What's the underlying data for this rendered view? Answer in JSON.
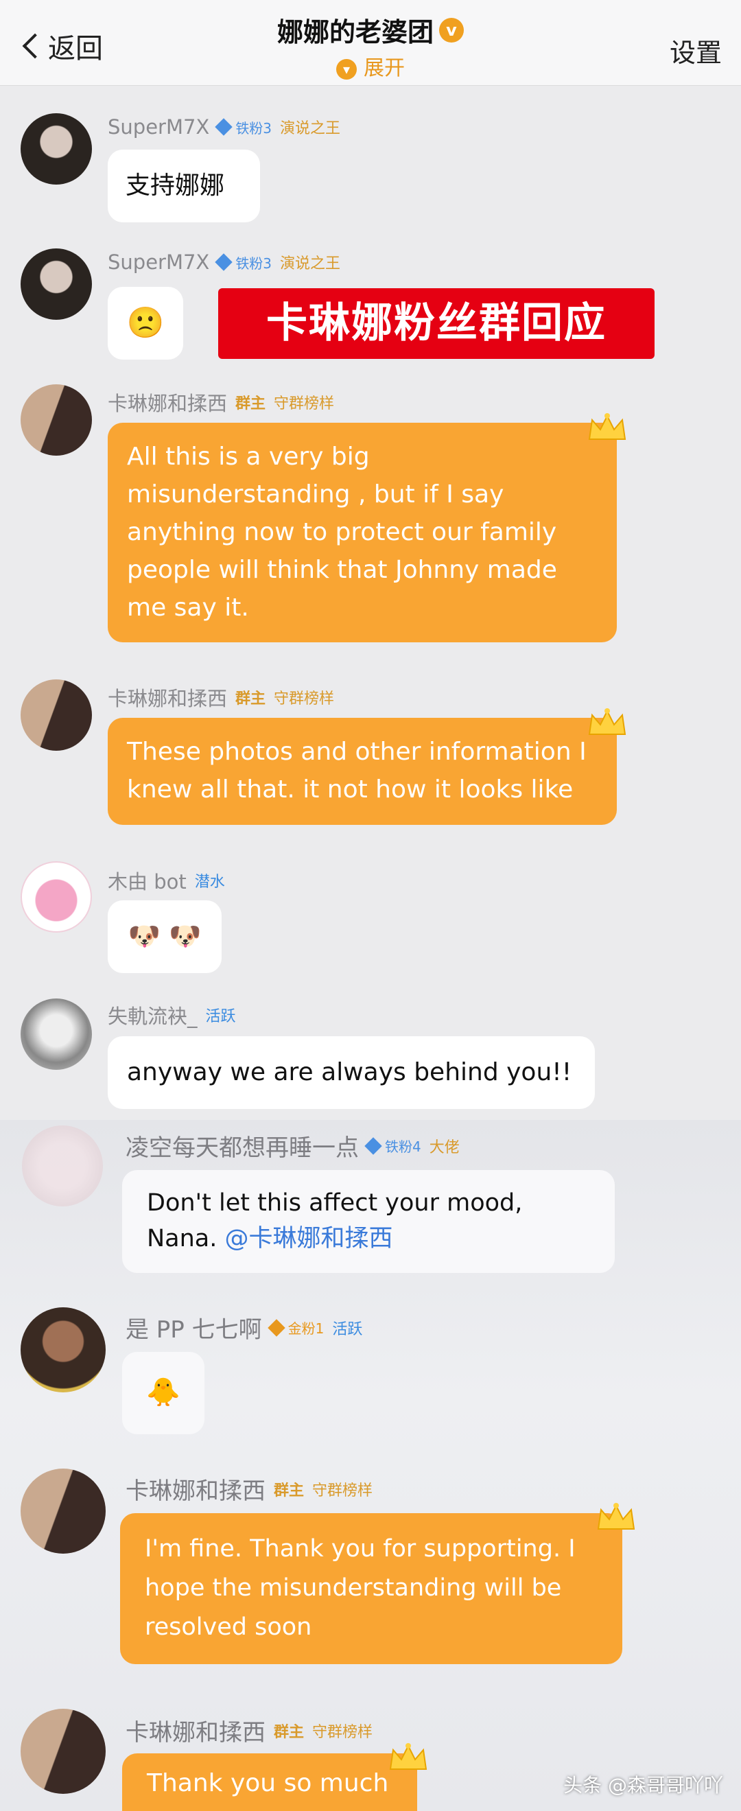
{
  "header": {
    "back_label": "返回",
    "title": "娜娜的老婆团",
    "verified_mark": "v",
    "expand_label": "展开",
    "settings_label": "设置"
  },
  "banner": {
    "text": "卡琳娜粉丝群回应"
  },
  "messages": [
    {
      "name": "SuperM7X",
      "fan_badge": "铁粉3",
      "title_badge": "演说之王",
      "text": "支持娜娜"
    },
    {
      "name": "SuperM7X",
      "fan_badge": "铁粉3",
      "title_badge": "演说之王",
      "text": "🙁"
    },
    {
      "name": "卡琳娜和揉西",
      "owner_badge": "群主",
      "title_badge": "守群榜样",
      "text": "All this is a very big misunderstanding , but if I say anything now to protect our family people will think that Johnny made me say it."
    },
    {
      "name": "卡琳娜和揉西",
      "owner_badge": "群主",
      "title_badge": "守群榜样",
      "text": "These photos and other information I knew all that. it not how it looks like"
    },
    {
      "name": "木由 bot",
      "status_badge": "潜水",
      "text": "🐶 🐶"
    },
    {
      "name": "失軌流袂_",
      "status_badge": "活跃",
      "text": "anyway we are always behind you!!"
    },
    {
      "name": "凌空每天都想再睡一点",
      "fan_badge": "铁粉4",
      "status_badge": "大佬",
      "text": "Don't let this affect your mood, Nana.",
      "mention": "@卡琳娜和揉西"
    },
    {
      "name": "是 PP 七七啊",
      "fan_badge": "金粉1",
      "status_badge": "活跃",
      "text": "🐥"
    },
    {
      "name": "卡琳娜和揉西",
      "owner_badge": "群主",
      "title_badge": "守群榜样",
      "text": "I'm fine. Thank you for supporting. I hope the misunderstanding will be resolved  soon"
    },
    {
      "name": "卡琳娜和揉西",
      "owner_badge": "群主",
      "title_badge": "守群榜样",
      "text": "Thank you so much"
    }
  ],
  "watermark": "头条 @森哥哥吖吖",
  "colors": {
    "accent": "#f9a533",
    "banner_red": "#e50012",
    "fan_blue": "#4a90e2"
  }
}
